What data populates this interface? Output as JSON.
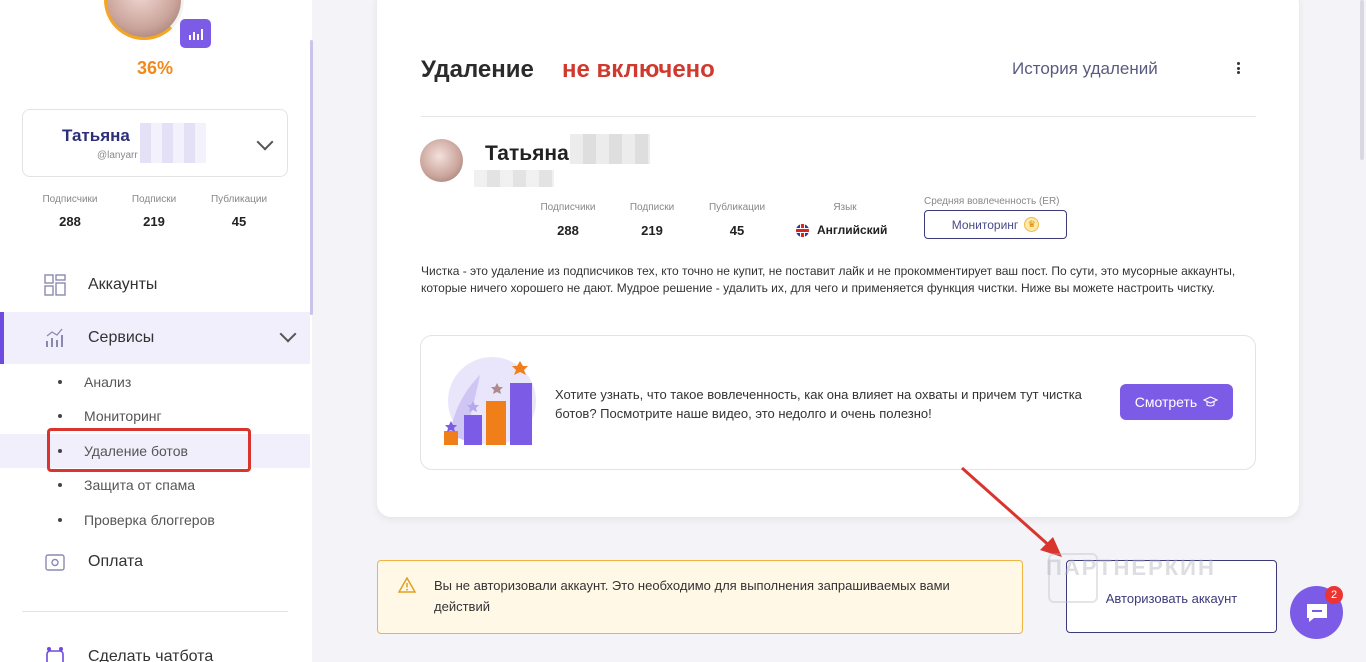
{
  "sidebar": {
    "percent": "36%",
    "account": {
      "name": "Татьяна",
      "handle": "@lanyarr"
    },
    "stats": [
      {
        "label": "Подписчики",
        "value": "288"
      },
      {
        "label": "Подписки",
        "value": "219"
      },
      {
        "label": "Публикации",
        "value": "45"
      }
    ],
    "nav": {
      "accounts": "Аккаунты",
      "services": "Сервисы",
      "payment": "Оплата",
      "chatbot": "Сделать чатбота"
    },
    "services_sub": [
      "Анализ",
      "Мониторинг",
      "Удаление ботов",
      "Защита от спама",
      "Проверка блоггеров"
    ],
    "active_sub_index": 2
  },
  "main": {
    "title": "Удаление",
    "status": "не включено",
    "history_link": "История удалений",
    "profile": {
      "name": "Татьяна",
      "stats": [
        {
          "label": "Подписчики",
          "value": "288"
        },
        {
          "label": "Подписки",
          "value": "219"
        },
        {
          "label": "Публикации",
          "value": "45"
        }
      ],
      "language_label": "Язык",
      "language_value": "Английский",
      "er_label": "Средняя вовлеченность (ER)",
      "er_button": "Мониторинг"
    },
    "description": "Чистка - это удаление из подписчиков тех, кто точно не купит, не поставит лайк и не прокомментирует ваш пост. По сути, это мусорные аккаунты, которые ничего хорошего не дают. Мудрое решение - удалить их, для чего и применяется функция чистки. Ниже вы можете настроить чистку.",
    "promo": {
      "text": "Хотите узнать, что такое вовлеченность, как она влияет на охваты и причем тут чистка ботов? Посмотрите наше видео, это недолго и очень полезно!",
      "button": "Смотреть"
    }
  },
  "warning": {
    "text": "Вы не авторизовали аккаунт. Это необходимо для выполнения запрашиваемых вами действий"
  },
  "auth_button": "Авторизовать аккаунт",
  "watermark": "ПАРТНЕРКИН",
  "chat": {
    "badge": "2"
  },
  "colors": {
    "accent": "#7c5ce6",
    "status_red": "#d0392e",
    "percent_orange": "#f08a1c",
    "warning_border": "#f0b440",
    "annotation_red": "#d9342e"
  }
}
